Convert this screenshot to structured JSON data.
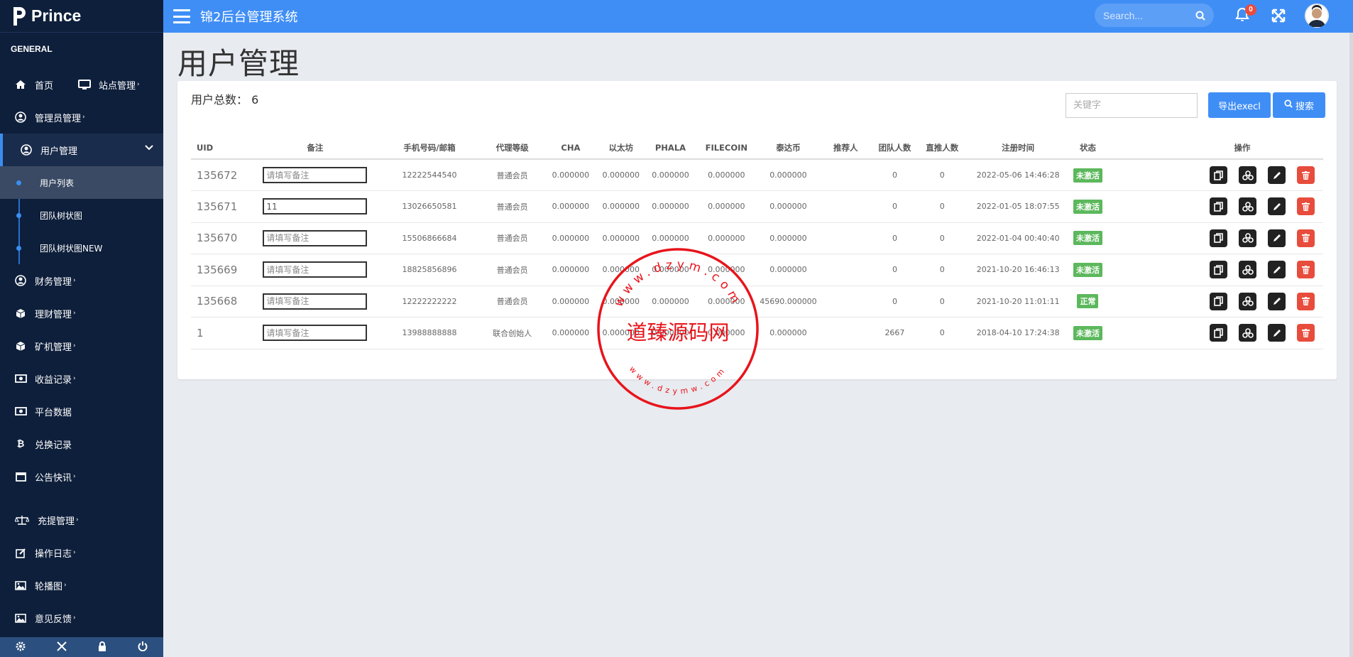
{
  "brand": {
    "name": "Prince"
  },
  "sidebar": {
    "section_label": "GENERAL",
    "home_label": "首页",
    "site_label": "站点管理",
    "items": [
      {
        "label": "管理员管理",
        "icon": "user-circle-icon"
      },
      {
        "label": "用户管理",
        "icon": "user-circle-icon"
      },
      {
        "label": "财务管理",
        "icon": "user-circle-icon"
      },
      {
        "label": "理财管理",
        "icon": "cube-icon"
      },
      {
        "label": "矿机管理",
        "icon": "cube-icon"
      },
      {
        "label": "收益记录",
        "icon": "money-icon"
      },
      {
        "label": "平台数据",
        "icon": "money-icon"
      },
      {
        "label": "兑换记录",
        "icon": "bitcoin-icon"
      },
      {
        "label": "公告快讯",
        "icon": "window-icon"
      },
      {
        "label": "充提管理",
        "icon": "scale-icon"
      },
      {
        "label": "操作日志",
        "icon": "edit-icon"
      },
      {
        "label": "轮播图",
        "icon": "image-icon"
      },
      {
        "label": "意见反馈",
        "icon": "image-icon"
      }
    ],
    "subitems": [
      "用户列表",
      "团队树状图",
      "团队树状图NEW"
    ],
    "caret": "›"
  },
  "topbar": {
    "title": "锦2后台管理系统",
    "search_placeholder": "Search...",
    "notification_count": "0"
  },
  "page": {
    "title": "用户管理",
    "total_label": "用户总数：",
    "total_value": "6",
    "keyword_placeholder": "关键字",
    "export_label": "导出execl",
    "search_label": "搜索"
  },
  "table": {
    "columns": [
      "UID",
      "备注",
      "手机号码/邮箱",
      "代理等级",
      "CHA",
      "以太坊",
      "PHALA",
      "FILECOIN",
      "泰达币",
      "推荐人",
      "团队人数",
      "直推人数",
      "注册时间",
      "状态",
      "操作"
    ],
    "note_placeholder": "请填写备注",
    "rows": [
      {
        "uid": "135672",
        "note": "",
        "phone": "12222544540",
        "level": "普通会员",
        "cha": "0.000000",
        "eth": "0.000000",
        "phala": "0.000000",
        "fil": "0.000000",
        "usdt": "0.000000",
        "referrer": "",
        "team": "0",
        "direct": "0",
        "time": "2022-05-06 14:46:28",
        "status": "未激活",
        "status_color": "#5cb85c"
      },
      {
        "uid": "135671",
        "note": "11",
        "phone": "13026650581",
        "level": "普通会员",
        "cha": "0.000000",
        "eth": "0.000000",
        "phala": "0.000000",
        "fil": "0.000000",
        "usdt": "0.000000",
        "referrer": "",
        "team": "0",
        "direct": "0",
        "time": "2022-01-05 18:07:55",
        "status": "未激活",
        "status_color": "#5cb85c"
      },
      {
        "uid": "135670",
        "note": "",
        "phone": "15506866684",
        "level": "普通会员",
        "cha": "0.000000",
        "eth": "0.000000",
        "phala": "0.000000",
        "fil": "0.000000",
        "usdt": "0.000000",
        "referrer": "",
        "team": "0",
        "direct": "0",
        "time": "2022-01-04 00:40:40",
        "status": "未激活",
        "status_color": "#5cb85c"
      },
      {
        "uid": "135669",
        "note": "",
        "phone": "18825856896",
        "level": "普通会员",
        "cha": "0.000000",
        "eth": "0.000000",
        "phala": "0.000000",
        "fil": "0.000000",
        "usdt": "0.000000",
        "referrer": "",
        "team": "0",
        "direct": "0",
        "time": "2021-10-20 16:46:13",
        "status": "未激活",
        "status_color": "#5cb85c"
      },
      {
        "uid": "135668",
        "note": "",
        "phone": "12222222222",
        "level": "普通会员",
        "cha": "0.000000",
        "eth": "0.000000",
        "phala": "0.000000",
        "fil": "0.000000",
        "usdt": "45690.000000",
        "referrer": "",
        "team": "0",
        "direct": "0",
        "time": "2021-10-20 11:01:11",
        "status": "正常",
        "status_color": "#5cb85c"
      },
      {
        "uid": "1",
        "note": "",
        "phone": "13988888888",
        "level": "联合创始人",
        "cha": "0.000000",
        "eth": "0.000000",
        "phala": "0.000000",
        "fil": "0.000000",
        "usdt": "0.000000",
        "referrer": "",
        "team": "2667",
        "direct": "0",
        "time": "2018-04-10 17:24:38",
        "status": "未激活",
        "status_color": "#5cb85c"
      }
    ]
  },
  "watermark": {
    "text": "道臻源码网",
    "top_url": "www.dzym.com",
    "bottom_url": "www.dzymw.com",
    "color": "#e8141b"
  },
  "colors": {
    "accent": "#3f8ef6",
    "sidebar": "#0e1f3b",
    "danger": "#e74c3c",
    "success": "#5cb85c"
  }
}
